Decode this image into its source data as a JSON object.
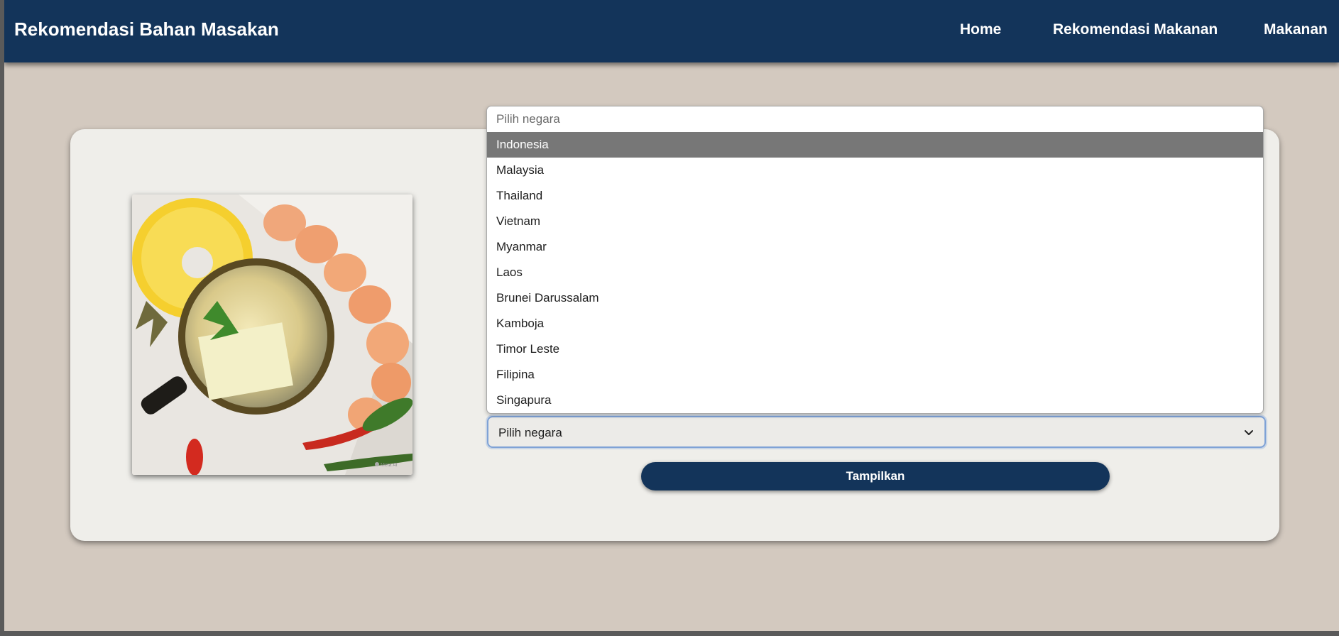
{
  "navbar": {
    "brand": "Rekomendasi Bahan Masakan",
    "links": [
      {
        "label": "Home"
      },
      {
        "label": "Rekomendasi Makanan"
      },
      {
        "label": "Makanan"
      }
    ]
  },
  "form": {
    "country_select": {
      "value": "Pilih negara",
      "icon": "chevron-down-icon"
    },
    "submit_label": "Tampilkan"
  },
  "dropdown": {
    "placeholder": "Pilih negara",
    "selected_index": 0,
    "options": [
      "Indonesia",
      "Malaysia",
      "Thailand",
      "Vietnam",
      "Myanmar",
      "Laos",
      "Brunei Darussalam",
      "Kamboja",
      "Timor Leste",
      "Filipina",
      "Singapura"
    ]
  },
  "hero_image": {
    "watermark": "Meta AI"
  },
  "colors": {
    "navbar": "#13345a",
    "page_bg": "#d3c9bf",
    "card_bg": "#efeeea",
    "highlight": "#777777",
    "focus_border": "#7fa2d6"
  }
}
